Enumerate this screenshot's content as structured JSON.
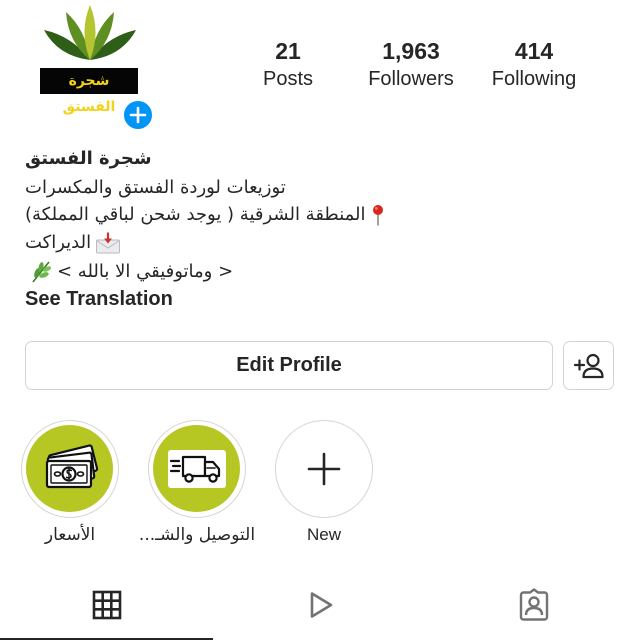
{
  "profile": {
    "logo_text": "شجرة الفستق",
    "add_story_icon": "plus-icon",
    "name": "شجرة الفستق",
    "bio": [
      {
        "text": "توزيعات لوردة الفستق والمكسرات"
      },
      {
        "text": "المنطقة الشرقية ( يوجد شحن لباقي المملكة)",
        "icon": "round-pushpin-icon"
      },
      {
        "text": "الديراكت",
        "icon": "incoming-envelope-icon"
      },
      {
        "text": "< وماتوفيقي الا بالله >",
        "icon": "herb-icon"
      }
    ],
    "see_translation": "See Translation"
  },
  "stats": [
    {
      "value": "21",
      "label": "Posts"
    },
    {
      "value": "1,963",
      "label": "Followers"
    },
    {
      "value": "414",
      "label": "Following"
    }
  ],
  "actions": {
    "edit_profile": "Edit Profile",
    "add_user_icon": "add-person-icon"
  },
  "highlights": [
    {
      "label": "الأسعار",
      "icon": "money-icon",
      "color": "#b6c724"
    },
    {
      "label": "التوصيل والشـ...",
      "icon": "delivery-truck-icon",
      "color": "#b6c724"
    },
    {
      "label": "New",
      "icon": "plus-icon"
    }
  ],
  "tabs": [
    {
      "icon": "grid-icon",
      "active": true
    },
    {
      "icon": "reels-icon",
      "active": false
    },
    {
      "icon": "tagged-icon",
      "active": false
    }
  ],
  "colors": {
    "accent": "#0095f6",
    "highlight": "#b6c724",
    "border": "#d3d3d3",
    "logo_text": "#f3d21a",
    "text": "#262626"
  }
}
